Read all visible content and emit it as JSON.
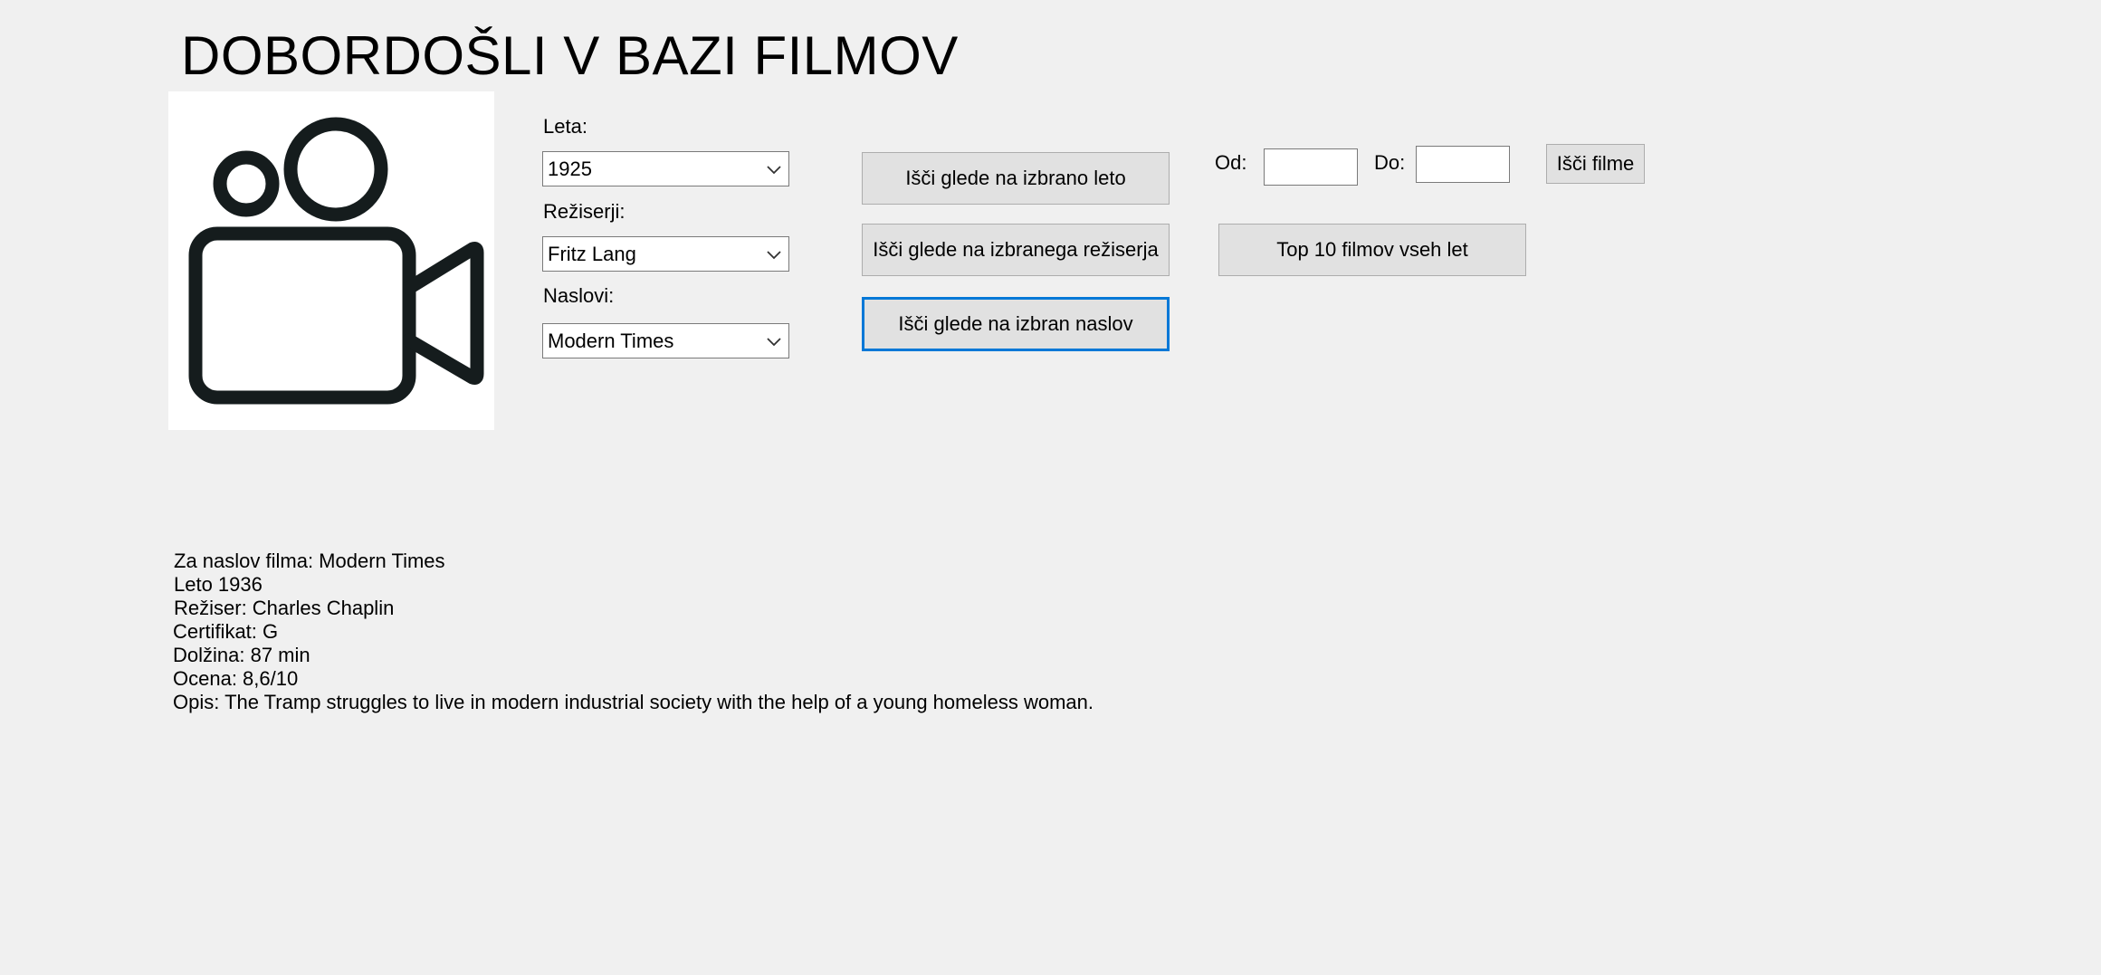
{
  "title": "DOBORDOŠLI V BAZI FILMOV",
  "logo_icon": "video-camera-icon",
  "filters": {
    "year_label": "Leta:",
    "year_value": "1925",
    "director_label": "Režiserji:",
    "director_value": "Fritz Lang",
    "title_label": "Naslovi:",
    "title_value": "Modern Times"
  },
  "buttons": {
    "search_year": "Išči glede na izbrano leto",
    "search_director": "Išči glede na izbranega režiserja",
    "search_title": "Išči glede na izbran naslov",
    "search_films": "Išči filme",
    "top10": "Top 10 filmov vseh let"
  },
  "range": {
    "from_label": "Od:",
    "from_value": "",
    "to_label": "Do:",
    "to_value": ""
  },
  "result": {
    "line1": "Za naslov filma: Modern Times",
    "line2": "Leto 1936",
    "line3": "Režiser: Charles Chaplin",
    "line4": "Certifikat: G",
    "line5": "Dolžina: 87 min",
    "line6": "Ocena: 8,6/10",
    "line7": "Opis: The Tramp struggles to live in modern industrial society with the help of a young homeless woman."
  },
  "colors": {
    "window_bg": "#f0f0f0",
    "button_bg": "#e1e1e1",
    "focus_accent": "#0078d7"
  }
}
